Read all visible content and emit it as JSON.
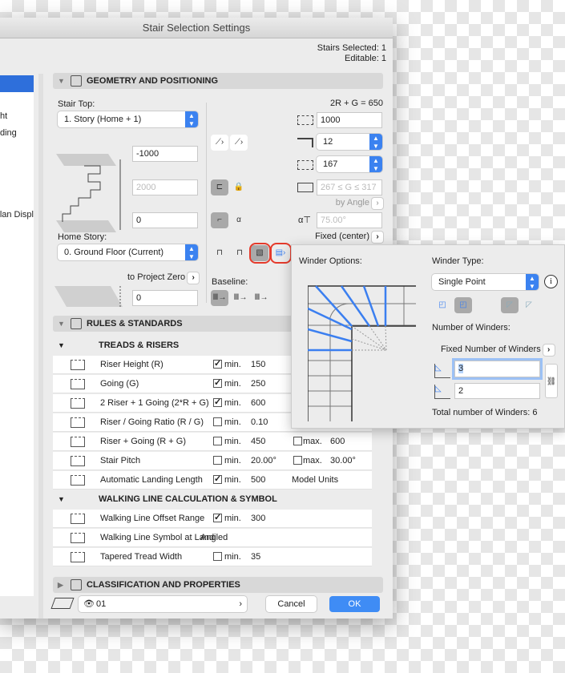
{
  "window": {
    "title": "Stair Selection Settings",
    "stairs_selected": "Stairs Selected: 1",
    "editable": "Editable: 1"
  },
  "sidebar": {
    "items": [
      "ht",
      "ding",
      "lan Displ"
    ]
  },
  "geometry": {
    "header": "GEOMETRY AND POSITIONING",
    "stair_top_label": "Stair Top:",
    "stair_top_value": "1. Story (Home + 1)",
    "top_offset": "-1000",
    "height": "2000",
    "bottom_offset": "0",
    "home_story_label": "Home Story:",
    "home_story_value": "0. Ground Floor (Current)",
    "to_project_zero": "to Project Zero",
    "project_zero_value": "0",
    "baseline_label": "Baseline:",
    "formula": "2R + G = 650",
    "stair_height": "1000",
    "risers": "12",
    "riser_height": "167",
    "going_range": "267 ≤ G ≤ 317",
    "by_angle": "by Angle",
    "angle": "75.00°",
    "fixed_center": "Fixed (center)"
  },
  "winder": {
    "options_label": "Winder Options:",
    "type_label": "Winder Type:",
    "type_value": "Single Point",
    "number_label": "Number of Winders:",
    "fixed_number": "Fixed Number of Winders",
    "first": "3",
    "second": "2",
    "total": "Total number of Winders: 6",
    "accent": "#3b7ff0"
  },
  "rules": {
    "header": "RULES & STANDARDS",
    "treads_header": "TREADS & RISERS",
    "treads": [
      {
        "label": "Riser Height (R)",
        "min_checked": true,
        "min": "min.",
        "min_value": "150"
      },
      {
        "label": "Going (G)",
        "min_checked": true,
        "min": "min.",
        "min_value": "250"
      },
      {
        "label": "2 Riser + 1 Going (2*R + G)",
        "min_checked": true,
        "min": "min.",
        "min_value": "600"
      },
      {
        "label": "Riser / Going Ratio (R / G)",
        "min_checked": false,
        "min": "min.",
        "min_value": "0.10"
      },
      {
        "label": "Riser + Going (R + G)",
        "min_checked": false,
        "min": "min.",
        "min_value": "450",
        "max_checked": false,
        "max": "max.",
        "max_value": "600"
      },
      {
        "label": "Stair Pitch",
        "min_checked": false,
        "min": "min.",
        "min_value": "20.00°",
        "max_checked": false,
        "max": "max.",
        "max_value": "30.00°"
      },
      {
        "label": "Automatic Landing Length",
        "min_checked": true,
        "min": "min.",
        "min_value": "500",
        "extra": "Model Units"
      }
    ],
    "walking_header": "WALKING LINE CALCULATION & SYMBOL",
    "walking": [
      {
        "label": "Walking Line Offset Range",
        "min_checked": true,
        "min": "min.",
        "min_value": "300"
      },
      {
        "label": "Walking Line Symbol at Landi",
        "extra": "Angled"
      },
      {
        "label": "Tapered Tread Width",
        "min_checked": false,
        "min": "min.",
        "min_value": "35"
      }
    ]
  },
  "classification": {
    "header": "CLASSIFICATION AND PROPERTIES"
  },
  "footer": {
    "layer": "01",
    "cancel": "Cancel",
    "ok": "OK"
  }
}
